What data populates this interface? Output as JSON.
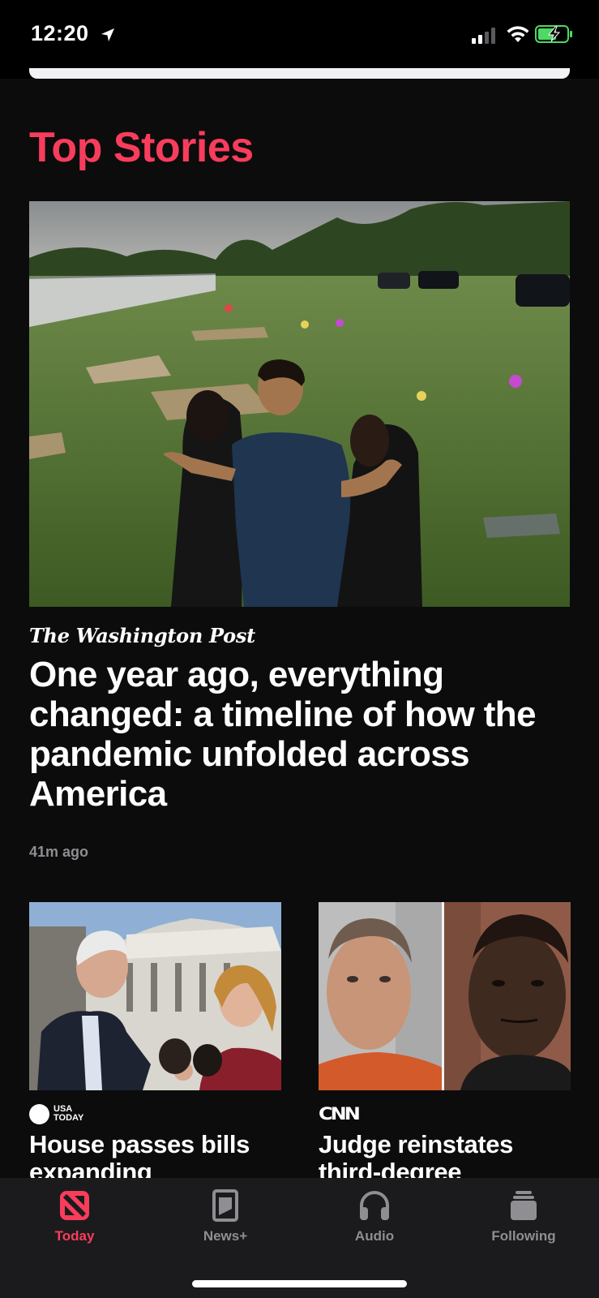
{
  "status_bar": {
    "time": "12:20",
    "icons": [
      "location-arrow-icon",
      "cellular-signal-icon",
      "wifi-icon",
      "battery-charging-icon"
    ],
    "battery_color": "#4cd964"
  },
  "section": {
    "title": "Top Stories",
    "accent_color": "#f83d5c"
  },
  "hero": {
    "publisher": "The Washington Post",
    "headline": "One year ago, everything changed: a timeline of how the pandemic unfolded across America",
    "time": "41m ago"
  },
  "cards": [
    {
      "publisher_line1": "USA",
      "publisher_line2": "TODAY",
      "headline": "House passes bills expanding"
    },
    {
      "publisher": "CNN",
      "headline": "Judge reinstates third-degree"
    }
  ],
  "tab_bar": {
    "tabs": [
      {
        "label": "Today",
        "icon": "news-logo-icon",
        "active": true
      },
      {
        "label": "News+",
        "icon": "magazine-icon",
        "active": false
      },
      {
        "label": "Audio",
        "icon": "headphones-icon",
        "active": false
      },
      {
        "label": "Following",
        "icon": "following-stack-icon",
        "active": false
      }
    ]
  }
}
